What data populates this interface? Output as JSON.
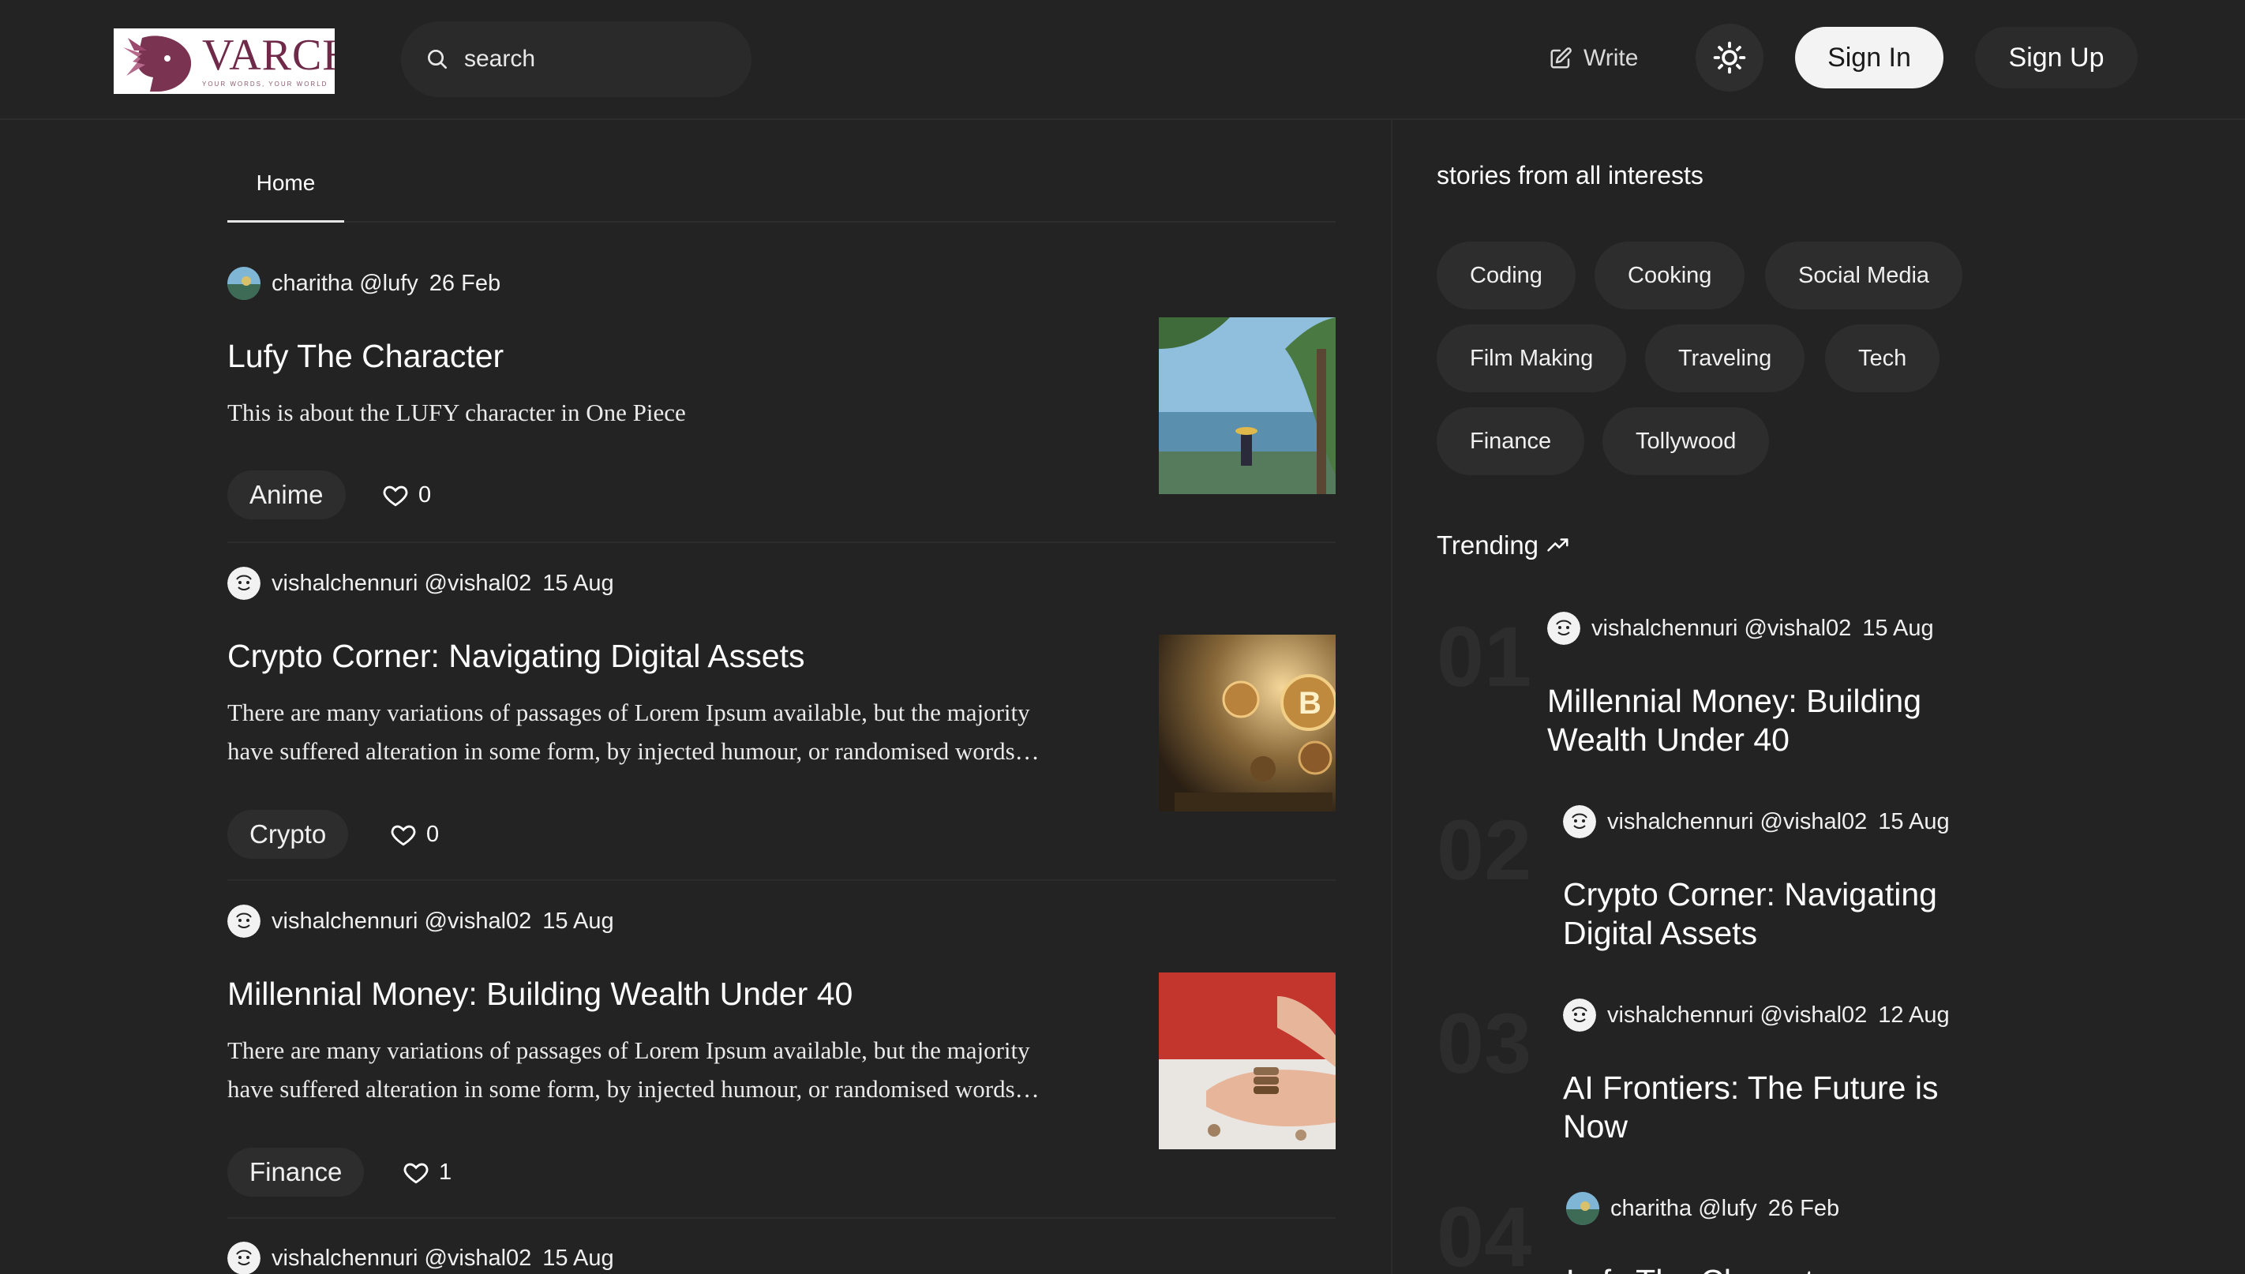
{
  "header": {
    "logo_text": "VARCH",
    "logo_tagline": "YOUR WORDS, YOUR WORLD",
    "search_placeholder": "search",
    "write_label": "Write",
    "theme_icon": "sun-icon",
    "signin_label": "Sign In",
    "signup_label": "Sign Up"
  },
  "tabs": [
    {
      "label": "Home"
    }
  ],
  "articles": [
    {
      "author": "charitha @lufy",
      "date": "26 Feb",
      "title": "Lufy The Character",
      "description": "This is about the LUFY character in One Piece",
      "tag": "Anime",
      "likes": "0"
    },
    {
      "author": "vishalchennuri @vishal02",
      "date": "15 Aug",
      "title": "Crypto Corner: Navigating Digital Assets",
      "description": "There are many variations of passages of Lorem Ipsum available, but the majority have suffered alteration in some form, by injected humour, or randomised words which don't look even slightly believable.",
      "tag": "Crypto",
      "likes": "0"
    },
    {
      "author": "vishalchennuri @vishal02",
      "date": "15 Aug",
      "title": "Millennial Money: Building Wealth Under 40",
      "description": "There are many variations of passages of Lorem Ipsum available, but the majority have suffered alteration in some form, by injected humour, or randomised words which don't look even slightly believable.",
      "tag": "Finance",
      "likes": "1"
    },
    {
      "author": "vishalchennuri @vishal02",
      "date": "15 Aug"
    }
  ],
  "sidebar": {
    "heading": "stories from all interests",
    "categories": [
      "Coding",
      "Cooking",
      "Social Media",
      "Film Making",
      "Traveling",
      "Tech",
      "Finance",
      "Tollywood"
    ],
    "trending_label": "Trending",
    "trending": [
      {
        "num": "01",
        "author": "vishalchennuri @vishal02",
        "date": "15 Aug",
        "title": "Millennial Money: Building Wealth Under 40"
      },
      {
        "num": "02",
        "author": "vishalchennuri @vishal02",
        "date": "15 Aug",
        "title": "Crypto Corner: Navigating Digital Assets"
      },
      {
        "num": "03",
        "author": "vishalchennuri @vishal02",
        "date": "12 Aug",
        "title": "AI Frontiers: The Future is Now"
      },
      {
        "num": "04",
        "author": "charitha @lufy",
        "date": "26 Feb",
        "title": "Lufy The Character"
      }
    ]
  },
  "colors": {
    "background": "#232323",
    "surface": "#2d2d2d",
    "brand": "#6e2a48"
  }
}
